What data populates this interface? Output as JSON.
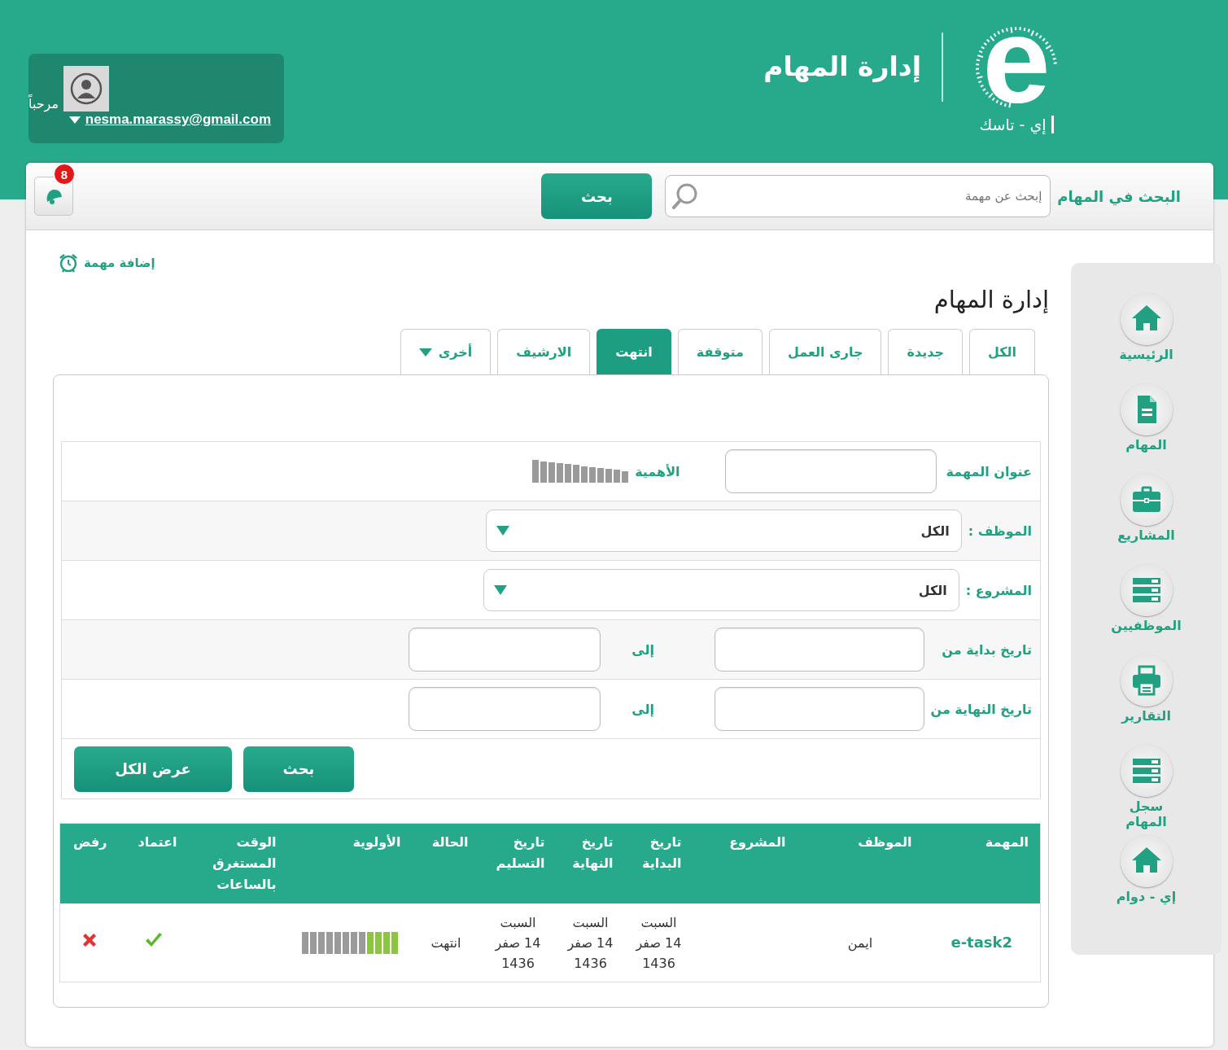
{
  "header": {
    "logo_letter": "e",
    "logo_caption": "إي - تاسك",
    "app_title": "إدارة المهام",
    "user": {
      "greeting": "مرحباً",
      "email": "nesma.marassy@gmail.com"
    }
  },
  "toolbar": {
    "notifications_count": "8",
    "search_label": "البحث في المهام",
    "search_placeholder": "إبحث عن مهمة",
    "search_button": "بحث"
  },
  "sidebar": {
    "items": [
      {
        "kind": "home",
        "label": "الرئيسية"
      },
      {
        "kind": "document",
        "label": "المهام"
      },
      {
        "kind": "briefcase",
        "label": "المشاريع"
      },
      {
        "kind": "list",
        "label": "الموظفيين"
      },
      {
        "kind": "printer",
        "label": "التقارير"
      },
      {
        "kind": "list",
        "label": "سجل المهام"
      },
      {
        "kind": "home",
        "label": "إي - دوام"
      }
    ]
  },
  "add_task": "إضافة مهمة",
  "page_title": "إدارة المهام",
  "tabs": [
    {
      "label": "الكل",
      "selected": false,
      "kind": "plain"
    },
    {
      "label": "جديدة",
      "selected": false,
      "kind": "plain"
    },
    {
      "label": "جارى العمل",
      "selected": false,
      "kind": "plain"
    },
    {
      "label": "متوقفة",
      "selected": false,
      "kind": "plain"
    },
    {
      "label": "انتهت",
      "selected": true,
      "kind": "plain"
    },
    {
      "label": "الارشيف",
      "selected": false,
      "kind": "plain"
    },
    {
      "label": "أخرى",
      "selected": false,
      "kind": "dropdown"
    }
  ],
  "filters": [
    {
      "kind": "text_meter",
      "label": "عنوان المهمة",
      "meter_label": "الأهمية"
    },
    {
      "kind": "select",
      "label": "الموظف :",
      "value": "الكل"
    },
    {
      "kind": "select",
      "label": "المشروع :",
      "value": "الكل"
    },
    {
      "kind": "range",
      "label": "تاريخ بداية من",
      "to_label": "إلى"
    },
    {
      "kind": "range",
      "label": "تاريخ النهاية من",
      "to_label": "إلى"
    }
  ],
  "filter_buttons": [
    "بحث",
    "عرض الكل"
  ],
  "table": {
    "columns": [
      "المهمة",
      "الموظف",
      "المشروع",
      "تاريخ البداية",
      "تاريخ النهاية",
      "تاريخ التسليم",
      "الحالة",
      "الأولوية",
      "الوقت المستغرق بالساعات",
      "اعتماد",
      "رفض"
    ],
    "rows": [
      {
        "task": "e-task2",
        "employee": "ايمن",
        "start": "السبت\n14 صفر\n1436",
        "end": "السبت\n14 صفر\n1436",
        "delivery": "السبت\n14 صفر\n1436",
        "status": "انتهت",
        "level": 0.33
      }
    ]
  }
}
